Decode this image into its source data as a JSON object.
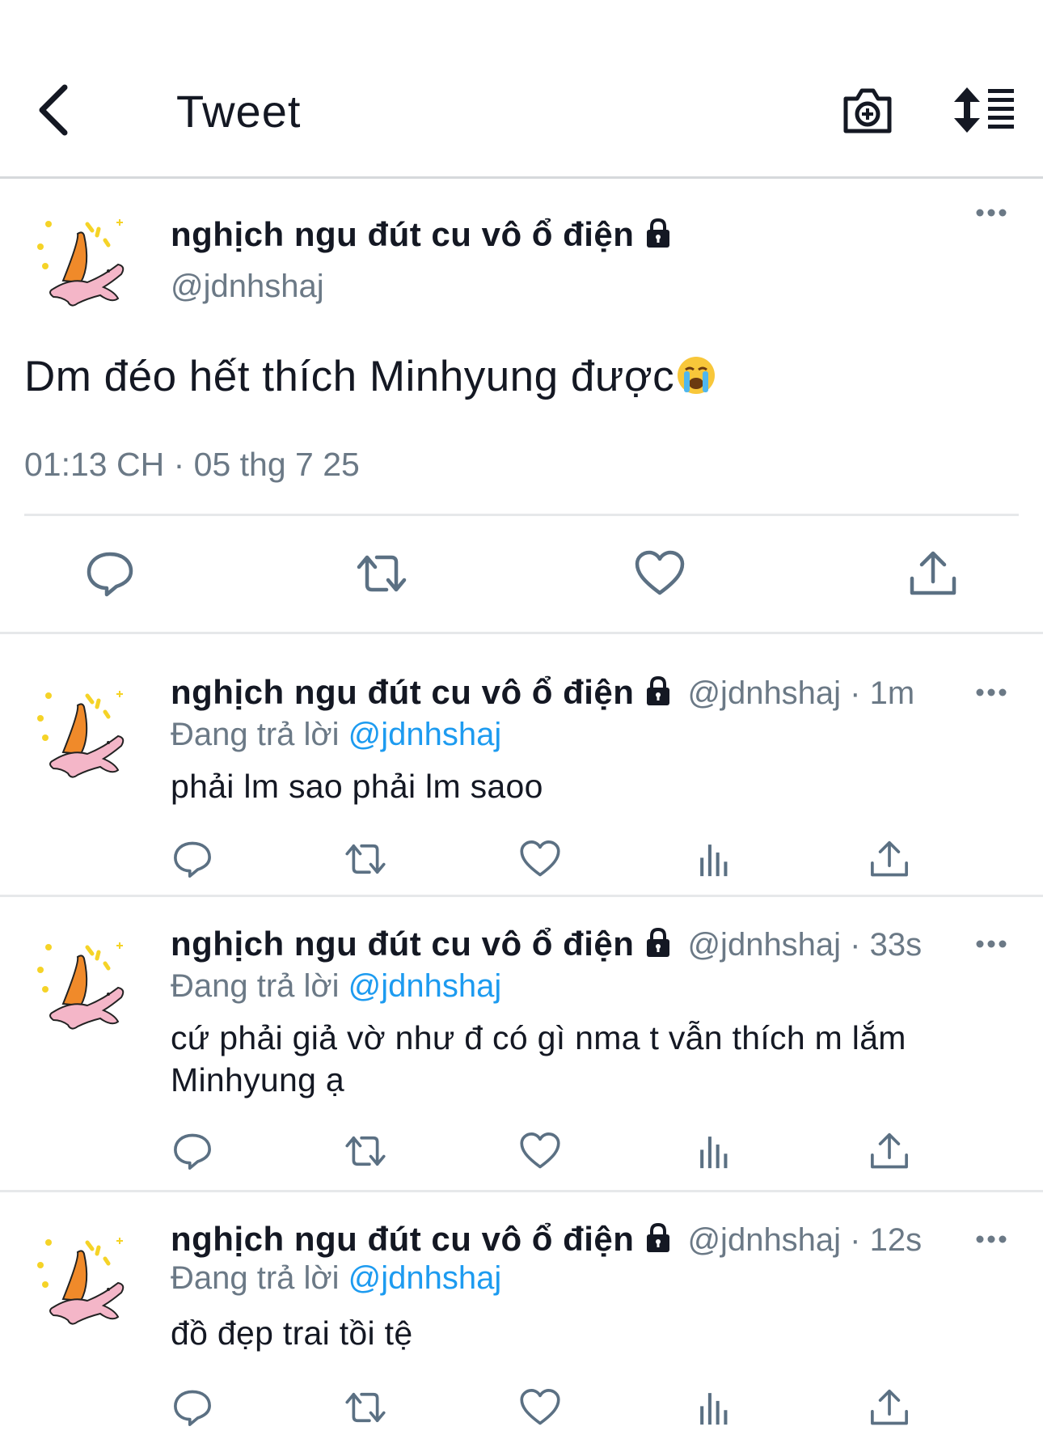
{
  "header": {
    "title": "Tweet",
    "back_icon": "chevron-left-icon",
    "camera_icon": "camera-add-icon",
    "sort_icon": "sort-list-icon"
  },
  "tweet": {
    "display_name": "nghịch ngu đút cu vô ổ điện",
    "handle": "@jdnhshaj",
    "text": "Dm đéo hết thích Minhyung được",
    "emoji": "loudly-crying-face",
    "timestamp": "01:13 CH · 05 thg 7 25"
  },
  "replies": [
    {
      "display_name": "nghịch ngu đút cu vô ổ điện",
      "meta": "@jdnhshaj · 1m",
      "replying_label": "Đang trả lời",
      "replying_to": "@jdnhshaj",
      "text": "phải lm sao phải lm saoo"
    },
    {
      "display_name": "nghịch ngu đút cu vô ổ điện",
      "meta": "@jdnhshaj · 33s",
      "replying_label": "Đang trả lời",
      "replying_to": "@jdnhshaj",
      "text": "cứ phải giả vờ như đ có gì nma t vẫn thích m lắm Minhyung ạ"
    },
    {
      "display_name": "nghịch ngu đút cu vô ổ điện",
      "meta": "@jdnhshaj · 12s",
      "replying_label": "Đang trả lời",
      "replying_to": "@jdnhshaj",
      "text": "đồ đẹp trai tồi tệ"
    }
  ],
  "colors": {
    "text": "#141823",
    "secondary": "#6b7986",
    "link": "#1d9bf0",
    "divider": "#e6e8ea",
    "icon": "#5b7083"
  }
}
